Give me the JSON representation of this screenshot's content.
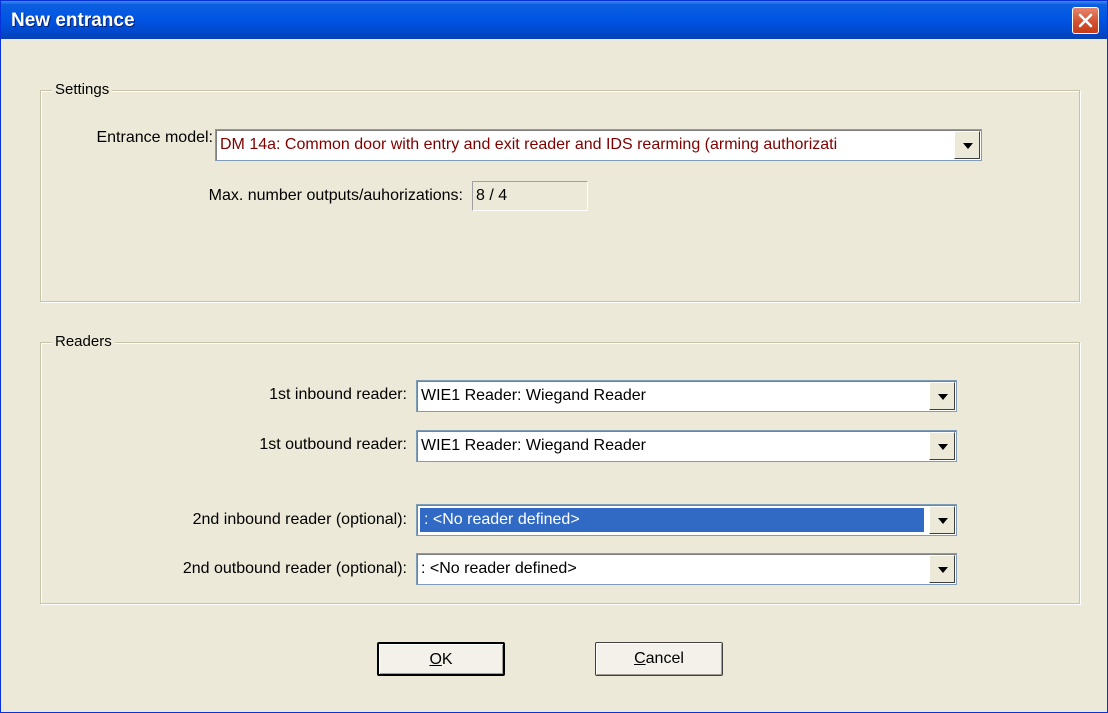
{
  "window": {
    "title": "New entrance"
  },
  "settings": {
    "legend": "Settings",
    "entrance_model_label": "Entrance model:",
    "entrance_model_value": "DM 14a: Common door with entry and exit reader and IDS rearming (arming authorizati",
    "max_outputs_label": "Max. number outputs/auhorizations:",
    "max_outputs_value": "8 / 4"
  },
  "readers": {
    "legend": "Readers",
    "rows": [
      {
        "label": "1st inbound reader:",
        "value": "WIE1 Reader: Wiegand Reader"
      },
      {
        "label": "1st outbound reader:",
        "value": "WIE1 Reader: Wiegand Reader"
      },
      {
        "label": "2nd inbound reader (optional):",
        "value": ": <No reader defined>"
      },
      {
        "label": "2nd outbound reader (optional):",
        "value": ": <No reader defined>"
      }
    ]
  },
  "buttons": {
    "ok": "OK",
    "cancel": "Cancel"
  },
  "icons": {
    "close": "close-icon",
    "dropdown": "chevron-down-icon"
  },
  "colors": {
    "title_bar": "#0054e3",
    "selection": "#316ac5",
    "model_text": "#800000"
  }
}
